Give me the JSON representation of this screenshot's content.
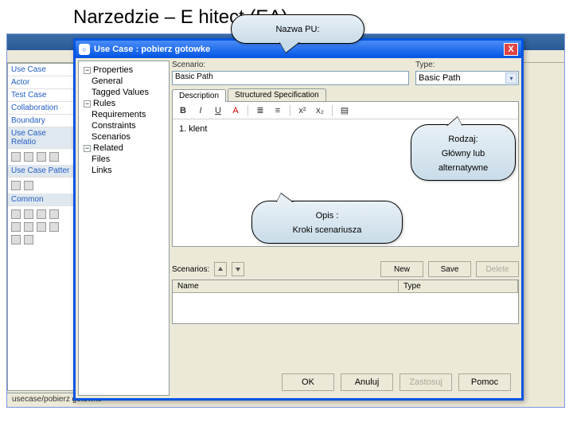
{
  "page": {
    "title": "Narzedzie – E                     hitect (EA)"
  },
  "bg": {
    "left_items": [
      "Use Case",
      "Actor",
      "Test Case",
      "Collaboration",
      "Boundary"
    ],
    "section1": "Use Case Relatio",
    "section2": "Use Case Patter",
    "section3": "Common",
    "bottom_tab": "usecase/pobierz gotowke"
  },
  "dialog": {
    "title": "Use Case : pobierz gotowke",
    "close": "X",
    "icon": "○"
  },
  "tree": {
    "nodes": [
      {
        "exp": "−",
        "label": "Properties"
      },
      {
        "lvl": 1,
        "label": "General"
      },
      {
        "lvl": 1,
        "label": "Tagged Values"
      },
      {
        "exp": "−",
        "label": "Rules"
      },
      {
        "lvl": 1,
        "label": "Requirements"
      },
      {
        "lvl": 1,
        "label": "Constraints"
      },
      {
        "lvl": 1,
        "label": "Scenarios"
      },
      {
        "exp": "−",
        "label": "Related"
      },
      {
        "lvl": 1,
        "label": "Files"
      },
      {
        "lvl": 1,
        "label": "Links"
      }
    ]
  },
  "fields": {
    "scenario_label": "Scenario:",
    "scenario_value": "Basic Path",
    "type_label": "Type:",
    "type_value": "Basic Path"
  },
  "tabs": {
    "description": "Description",
    "structured": "Structured Specification"
  },
  "toolbar": {
    "b": "B",
    "i": "I",
    "u": "U",
    "color": "A",
    "ul": "≣",
    "ol": "≡",
    "sup": "x²",
    "sub": "x₂",
    "note": "▤"
  },
  "editor": {
    "line1": "1. klent"
  },
  "scenarios": {
    "label": "Scenarios:",
    "new": "New",
    "save": "Save",
    "delete": "Delete",
    "col_name": "Name",
    "col_type": "Type"
  },
  "footer": {
    "ok": "OK",
    "cancel": "Anuluj",
    "apply": "Zastosuj",
    "help": "Pomoc"
  },
  "callouts": {
    "name_pu": "Nazwa PU:",
    "rodzaj_l1": "Rodzaj:",
    "rodzaj_l2": "Główny lub",
    "rodzaj_l3": "alternatywne",
    "opis_l1": "Opis :",
    "opis_l2": "Kroki scenariusza"
  }
}
